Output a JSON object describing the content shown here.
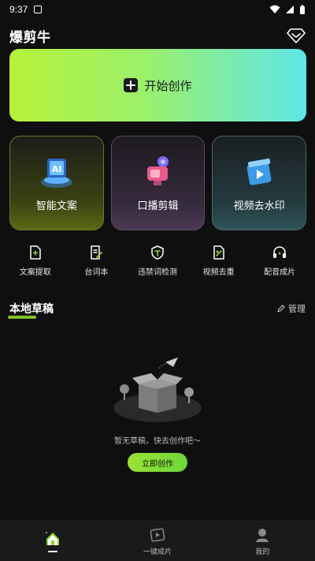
{
  "status_bar": {
    "time": "9:37"
  },
  "header": {
    "app_title": "爆剪牛"
  },
  "create_banner": {
    "label": "开始创作"
  },
  "feature_cards": [
    {
      "label": "智能文案",
      "icon": "ai-cube-icon"
    },
    {
      "label": "口播剪辑",
      "icon": "camera-robot-icon"
    },
    {
      "label": "视频去水印",
      "icon": "video-clapper-icon"
    }
  ],
  "tools": [
    {
      "label": "文案提取",
      "icon": "doc-extract-icon"
    },
    {
      "label": "台词本",
      "icon": "script-edit-icon"
    },
    {
      "label": "违禁词检测",
      "icon": "shield-check-icon"
    },
    {
      "label": "视频去重",
      "icon": "video-dedupe-icon"
    },
    {
      "label": "配音成片",
      "icon": "headset-icon"
    }
  ],
  "drafts": {
    "title": "本地草稿",
    "manage_label": "管理",
    "empty_text": "暂无草稿，快去创作吧～",
    "create_now_label": "立即创作"
  },
  "bottom_nav": [
    {
      "label": "",
      "icon": "home-icon",
      "active": true
    },
    {
      "label": "一键成片",
      "icon": "film-icon",
      "active": false
    },
    {
      "label": "我的",
      "icon": "profile-icon",
      "active": false
    }
  ],
  "colors": {
    "accent_green": "#9be334",
    "banner_start": "#b6f23a",
    "banner_end": "#5ee6e8",
    "background": "#0f0f10"
  }
}
